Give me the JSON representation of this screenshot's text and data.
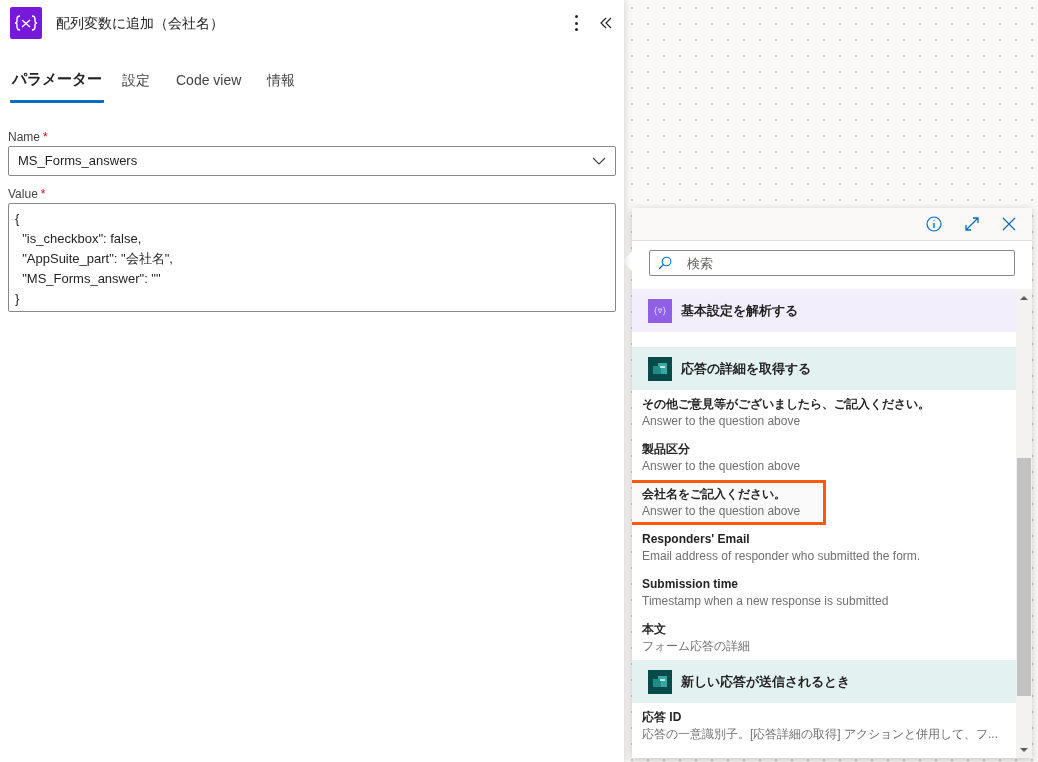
{
  "panel": {
    "title": "配列変数に追加（会社名）",
    "tabs": [
      {
        "label": "パラメーター",
        "selected": true
      },
      {
        "label": "設定",
        "selected": false
      },
      {
        "label": "Code view",
        "selected": false
      },
      {
        "label": "情報",
        "selected": false
      }
    ],
    "fields": [
      {
        "label": "Name",
        "required": "*",
        "kind": "dropdown",
        "value": "MS_Forms_answers"
      },
      {
        "label": "Value",
        "required": "*",
        "kind": "textarea",
        "lines": [
          "{",
          "  \"is_checkbox\": false,",
          "  \"AppSuite_part\": \"会社名\",",
          "  \"MS_Forms_answer\": \"\"",
          "}"
        ]
      }
    ]
  },
  "picker": {
    "search": {
      "placeholder": "検索"
    },
    "groups": [
      {
        "title": "基本設定を解析する",
        "kind": "variable"
      },
      {
        "title": "応答の詳細を取得する",
        "kind": "forms",
        "items": [
          {
            "title": "その他ご意見等がございましたら、ご記入ください。",
            "description": "Answer to the question above",
            "highlighted": false
          },
          {
            "title": "製品区分",
            "description": "Answer to the question above",
            "highlighted": false
          },
          {
            "title": "会社名をご記入ください。",
            "description": "Answer to the question above",
            "highlighted": true
          },
          {
            "title": "Responders' Email",
            "description": "Email address of responder who submitted the form.",
            "highlighted": false
          },
          {
            "title": "Submission time",
            "description": "Timestamp when a new response is submitted",
            "highlighted": false
          },
          {
            "title": "本文",
            "description": "フォーム応答の詳細",
            "highlighted": false
          }
        ]
      },
      {
        "title": "新しい応答が送信されるとき",
        "kind": "forms",
        "items": [
          {
            "title": "応答 ID",
            "description": "応答の一意識別子。[応答詳細の取得] アクションと併用して、フ...",
            "highlighted": false
          }
        ]
      }
    ]
  }
}
